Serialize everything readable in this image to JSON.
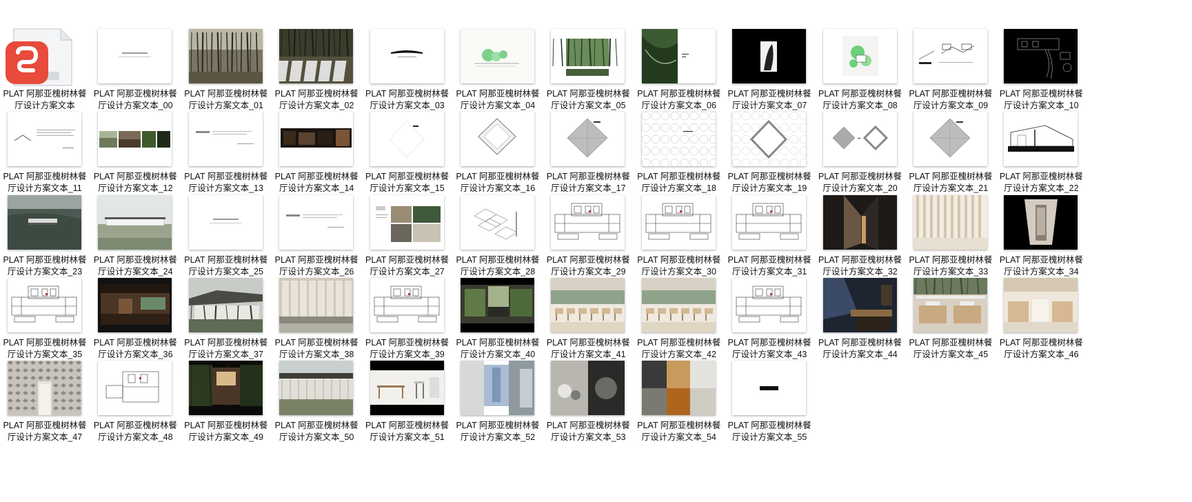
{
  "files": [
    {
      "name": "PLAT 阿那亚槐树林餐厅设计方案文本",
      "type": "pdf",
      "icon": "pdf-app-icon"
    },
    {
      "name": "PLAT 阿那亚槐树林餐厅设计方案文本_00",
      "type": "text-page"
    },
    {
      "name": "PLAT 阿那亚槐树林餐厅设计方案文本_01",
      "type": "forest-photo"
    },
    {
      "name": "PLAT 阿那亚槐树林餐厅设计方案文本_02",
      "type": "forest-deck"
    },
    {
      "name": "PLAT 阿那亚槐树林餐厅设计方案文本_03",
      "type": "title-bar"
    },
    {
      "name": "PLAT 阿那亚槐树林餐厅设计方案文本_04",
      "type": "green-sketch"
    },
    {
      "name": "PLAT 阿那亚槐树林餐厅设计方案文本_05",
      "type": "forest-frame"
    },
    {
      "name": "PLAT 阿那亚槐树林餐厅设计方案文本_06",
      "type": "half-forest"
    },
    {
      "name": "PLAT 阿那亚槐树林餐厅设计方案文本_07",
      "type": "black-figure"
    },
    {
      "name": "PLAT 阿那亚槐树林餐厅设计方案文本_08",
      "type": "green-plan"
    },
    {
      "name": "PLAT 阿那亚槐树林餐厅设计方案文本_09",
      "type": "diagram-lines"
    },
    {
      "name": "PLAT 阿那亚槐树林餐厅设计方案文本_10",
      "type": "black-plan"
    },
    {
      "name": "PLAT 阿那亚槐树林餐厅设计方案文本_11",
      "type": "roof-line"
    },
    {
      "name": "PLAT 阿那亚槐树林餐厅设计方案文本_12",
      "type": "photo-strip"
    },
    {
      "name": "PLAT 阿那亚槐树林餐厅设计方案文本_13",
      "type": "text-small"
    },
    {
      "name": "PLAT 阿那亚槐树林餐厅设计方案文本_14",
      "type": "dark-strip"
    },
    {
      "name": "PLAT 阿那亚槐树林餐厅设计方案文本_15",
      "type": "thin-diamond"
    },
    {
      "name": "PLAT 阿那亚槐树林餐厅设计方案文本_16",
      "type": "diamond-outline"
    },
    {
      "name": "PLAT 阿那亚槐树林餐厅设计方案文本_17",
      "type": "diamond-grey"
    },
    {
      "name": "PLAT 阿那亚槐树林餐厅设计方案文本_18",
      "type": "tree-pattern"
    },
    {
      "name": "PLAT 阿那亚槐树林餐厅设计方案文本_19",
      "type": "tree-diamond"
    },
    {
      "name": "PLAT 阿那亚槐树林餐厅设计方案文本_20",
      "type": "two-diamonds"
    },
    {
      "name": "PLAT 阿那亚槐树林餐厅设计方案文本_21",
      "type": "diamond-grey"
    },
    {
      "name": "PLAT 阿那亚槐树林餐厅设计方案文本_22",
      "type": "section"
    },
    {
      "name": "PLAT 阿那亚槐树林餐厅设计方案文本_23",
      "type": "aerial"
    },
    {
      "name": "PLAT 阿那亚槐树林餐厅设计方案文本_24",
      "type": "landscape"
    },
    {
      "name": "PLAT 阿那亚槐树林餐厅设计方案文本_25",
      "type": "text-page"
    },
    {
      "name": "PLAT 阿那亚槐树林餐厅设计方案文本_26",
      "type": "text-small"
    },
    {
      "name": "PLAT 阿那亚槐树林餐厅设计方案文本_27",
      "type": "collage"
    },
    {
      "name": "PLAT 阿那亚槐树林餐厅设计方案文本_28",
      "type": "axon"
    },
    {
      "name": "PLAT 阿那亚槐树林餐厅设计方案文本_29",
      "type": "plan"
    },
    {
      "name": "PLAT 阿那亚槐树林餐厅设计方案文本_30",
      "type": "plan"
    },
    {
      "name": "PLAT 阿那亚槐树林餐厅设计方案文本_31",
      "type": "plan"
    },
    {
      "name": "PLAT 阿那亚槐树林餐厅设计方案文本_32",
      "type": "corridor-dark"
    },
    {
      "name": "PLAT 阿那亚槐树林餐厅设计方案文本_33",
      "type": "corridor-light"
    },
    {
      "name": "PLAT 阿那亚槐树林餐厅设计方案文本_34",
      "type": "corridor-black"
    },
    {
      "name": "PLAT 阿那亚槐树林餐厅设计方案文本_35",
      "type": "plan"
    },
    {
      "name": "PLAT 阿那亚槐树林餐厅设计方案文本_36",
      "type": "interior-dark"
    },
    {
      "name": "PLAT 阿那亚槐树林餐厅设计方案文本_37",
      "type": "pavilion"
    },
    {
      "name": "PLAT 阿那亚槐树林餐厅设计方案文本_38",
      "type": "glass-room"
    },
    {
      "name": "PLAT 阿那亚槐树林餐厅设计方案文本_39",
      "type": "plan"
    },
    {
      "name": "PLAT 阿那亚槐树林餐厅设计方案文本_40",
      "type": "interior-green"
    },
    {
      "name": "PLAT 阿那亚槐树林餐厅设计方案文本_41",
      "type": "dining"
    },
    {
      "name": "PLAT 阿那亚槐树林餐厅设计方案文本_42",
      "type": "dining"
    },
    {
      "name": "PLAT 阿那亚槐树林餐厅设计方案文本_43",
      "type": "plan"
    },
    {
      "name": "PLAT 阿那亚槐树林餐厅设计方案文本_44",
      "type": "bar-dark"
    },
    {
      "name": "PLAT 阿那亚槐树林餐厅设计方案文本_45",
      "type": "booth"
    },
    {
      "name": "PLAT 阿那亚槐树林餐厅设计方案文本_46",
      "type": "booth-light"
    },
    {
      "name": "PLAT 阿那亚槐树林餐厅设计方案文本_47",
      "type": "screen-wall"
    },
    {
      "name": "PLAT 阿那亚槐树林餐厅设计方案文本_48",
      "type": "plan-small"
    },
    {
      "name": "PLAT 阿那亚槐树林餐厅设计方案文本_49",
      "type": "night-room"
    },
    {
      "name": "PLAT 阿那亚槐树林餐厅设计方案文本_50",
      "type": "pavilion-front"
    },
    {
      "name": "PLAT 阿那亚槐树林餐厅设计方案文本_51",
      "type": "furniture"
    },
    {
      "name": "PLAT 阿那亚槐树林餐厅设计方案文本_52",
      "type": "fabric"
    },
    {
      "name": "PLAT 阿那亚槐树林餐厅设计方案文本_53",
      "type": "ceramics"
    },
    {
      "name": "PLAT 阿那亚槐树林餐厅设计方案文本_54",
      "type": "materials"
    },
    {
      "name": "PLAT 阿那亚槐树林餐厅设计方案文本_55",
      "type": "end-page"
    }
  ]
}
